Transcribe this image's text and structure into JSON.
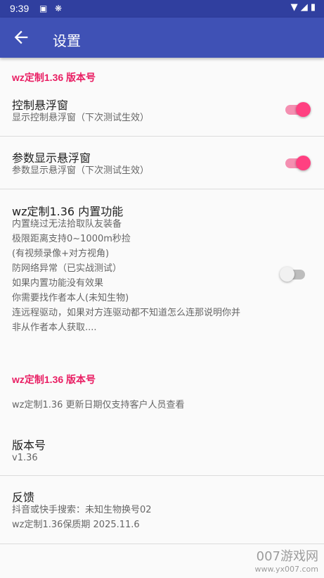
{
  "statusbar": {
    "time": "9:39"
  },
  "appbar": {
    "title": "设置"
  },
  "section1": {
    "header": "wz定制1.36 版本号"
  },
  "pref_control": {
    "title": "控制悬浮窗",
    "summary": "显示控制悬浮窗（下次测试生效）",
    "checked": true
  },
  "pref_param": {
    "title": "参数显示悬浮窗",
    "summary": "参数显示悬浮窗（下次测试生效）",
    "checked": true
  },
  "pref_builtin": {
    "title": "wz定制1.36 内置功能",
    "lines": [
      "内置绕过无法拾取队友装备",
      "极限距离支持0~1000m秒捡",
      "(有视频录像+对方视角)",
      "防网络异常（已实战测试）",
      "如果内置功能没有效果",
      "你需要找作者本人(未知生物)",
      "连远程驱动，如果对方连驱动都不知道怎么连那说明你并",
      "非从作者本人获取...."
    ],
    "checked": false
  },
  "section2": {
    "header": "wz定制1.36 版本号"
  },
  "pref_update": {
    "summary": "wz定制1.36 更新日期仅支持客户人员查看"
  },
  "pref_version": {
    "title": "版本号",
    "summary": "v1.36"
  },
  "pref_feedback": {
    "title": "反馈",
    "summary_lines": [
      "抖音或快手搜索：未知生物换号02",
      "wz定制1.36保质期 2025.11.6"
    ]
  },
  "watermark": {
    "brand": "007游戏网",
    "url": "www.yx007.com"
  }
}
